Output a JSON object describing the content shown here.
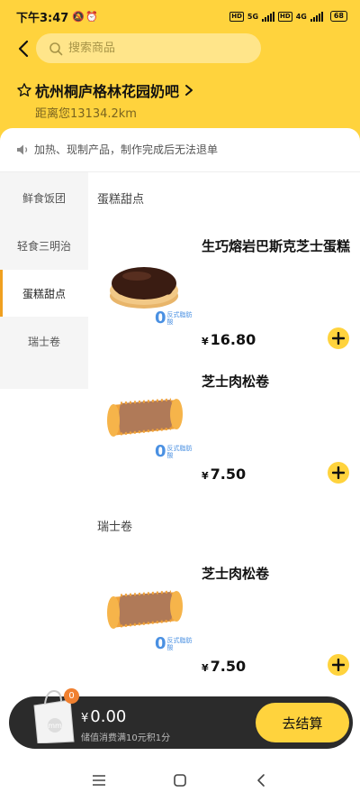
{
  "status_bar": {
    "time": "下午3:47",
    "alerts": "🔕⏰",
    "hd1": "HD",
    "net1": "5G",
    "hd2": "HD",
    "net2": "4G",
    "battery": "68"
  },
  "search": {
    "placeholder": "搜索商品"
  },
  "store": {
    "name": "杭州桐庐格林花园奶吧",
    "distance": "距离您13134.2km"
  },
  "notice": "加热、现制产品，制作完成后无法退单",
  "sidebar": {
    "items": [
      {
        "label": "鲜食饭团"
      },
      {
        "label": "轻食三明治"
      },
      {
        "label": "蛋糕甜点",
        "active": true
      },
      {
        "label": "瑞士卷"
      }
    ]
  },
  "sections": [
    {
      "title": "蛋糕甜点",
      "products": [
        {
          "name": "生巧熔岩巴斯克芝士蛋糕",
          "currency": "¥",
          "price": "16.80",
          "badge_zero": "0",
          "badge_text": "反式脂肪酸"
        },
        {
          "name": "芝士肉松卷",
          "currency": "¥",
          "price": "7.50",
          "badge_zero": "0",
          "badge_text": "反式脂肪酸"
        }
      ]
    },
    {
      "title": "瑞士卷",
      "products": [
        {
          "name": "芝士肉松卷",
          "currency": "¥",
          "price": "7.50",
          "badge_zero": "0",
          "badge_text": "反式脂肪酸"
        }
      ]
    }
  ],
  "cart": {
    "count": "0",
    "currency": "¥",
    "total": "0.00",
    "note": "储值消费满10元积1分",
    "checkout_label": "去结算",
    "bag_logo": "mm"
  },
  "colors": {
    "brand_yellow": "#FFD33D",
    "badge_blue": "#4a90e2",
    "active_bar": "#F0A020",
    "cart_count": "#F08030"
  },
  "icons": [
    "back-icon",
    "search-icon",
    "star-icon",
    "chevron-right-icon",
    "speaker-icon",
    "plus-icon",
    "shopping-bag-icon",
    "menu-icon",
    "home-icon",
    "back-nav-icon"
  ]
}
